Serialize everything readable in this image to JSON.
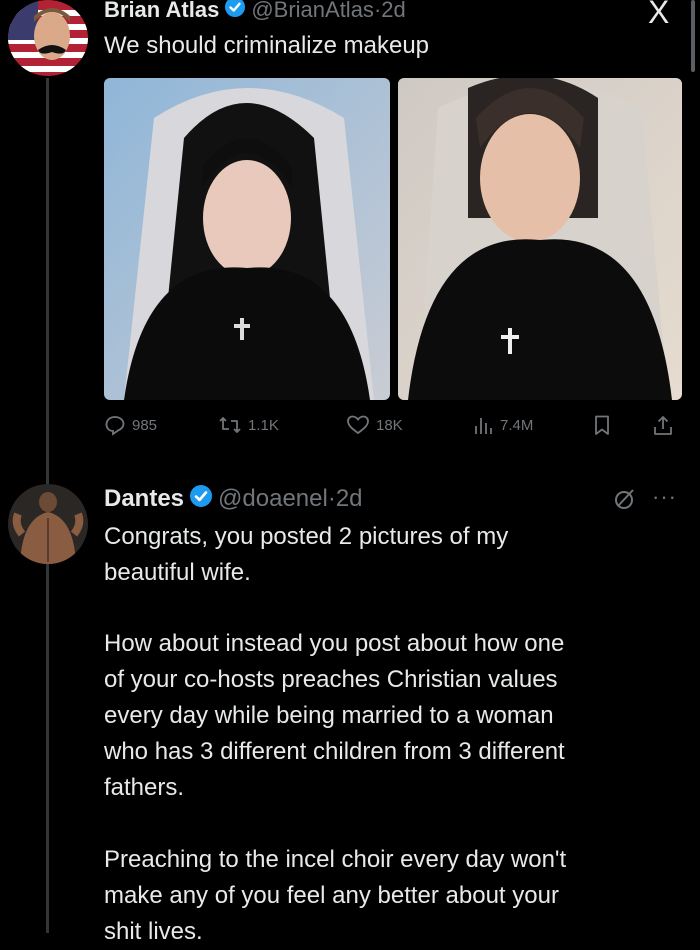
{
  "header": {
    "close_glyph": "X"
  },
  "tweets": [
    {
      "author": {
        "name": "Brian Atlas",
        "handle": "@BrianAtlas",
        "time": "2d",
        "avatar": "flag-mustache-avatar"
      },
      "text": "We should criminalize makeup",
      "photos": [
        "woman-with-makeup-photo",
        "woman-without-makeup-photo"
      ],
      "stats": {
        "replies": "985",
        "reposts": "1.1K",
        "likes": "18K",
        "views": "7.4M"
      }
    },
    {
      "author": {
        "name": "Dantes",
        "handle": "@doaenel",
        "time": "2d",
        "avatar": "muscular-back-avatar"
      },
      "paragraphs": [
        [
          "Congrats, you posted 2 pictures of my",
          "beautiful wife."
        ],
        [
          "How about instead you post about how one",
          "of your co-hosts preaches Christian values",
          "every day while being married to a woman",
          "who has 3 different children from 3 different",
          "fathers."
        ],
        [
          "Preaching to the incel choir every day won't",
          "make any of you feel any better about your",
          "shit lives."
        ]
      ]
    }
  ],
  "colors": {
    "background": "#000000",
    "text": "#e7e9ea",
    "muted": "#71767b",
    "verified": "#1d9bf0"
  }
}
